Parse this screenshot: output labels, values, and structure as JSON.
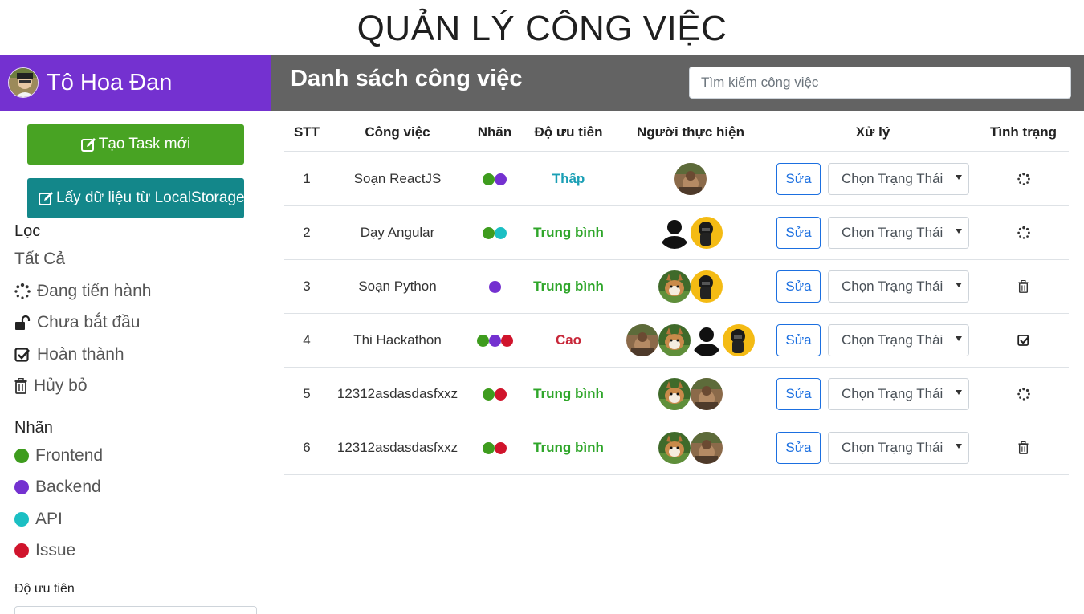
{
  "app": {
    "title": "QUẢN LÝ CÔNG VIỆC"
  },
  "user": {
    "name": "Tô Hoa Đan"
  },
  "header": {
    "title": "Danh sách công việc"
  },
  "search": {
    "placeholder": "Tìm kiếm công việc",
    "value": ""
  },
  "sidebar": {
    "new_task_label": "Tạo Task mới",
    "local_storage_label": "Lấy dữ liệu từ LocalStorage",
    "filter_title": "Lọc",
    "filters": [
      {
        "label": "Tất Cả",
        "icon": ""
      },
      {
        "label": "Đang tiến hành",
        "icon": "spinner-icon"
      },
      {
        "label": "Chưa bắt đầu",
        "icon": "unlock-icon"
      },
      {
        "label": "Hoàn thành",
        "icon": "check-square-icon"
      },
      {
        "label": "Hủy bỏ",
        "icon": "trash-icon"
      }
    ],
    "labels_title": "Nhãn",
    "labels": [
      {
        "label": "Frontend",
        "color": "#3e9c1e"
      },
      {
        "label": "Backend",
        "color": "#7431d0"
      },
      {
        "label": "API",
        "color": "#1bbfc3"
      },
      {
        "label": "Issue",
        "color": "#d0142c"
      }
    ],
    "priority_title": "Độ ưu tiên"
  },
  "table": {
    "headers": [
      "STT",
      "Công việc",
      "Nhãn",
      "Độ ưu tiên",
      "Người thực hiện",
      "Xử lý",
      "Tình trạng"
    ],
    "edit_label": "Sửa",
    "status_select_label": "Chọn Trạng Thái",
    "rows": [
      {
        "stt": "1",
        "task": "Soạn ReactJS",
        "tags": [
          "#3e9c1e",
          "#7431d0"
        ],
        "priority": "Thấp",
        "priority_color": "#1a9fb5",
        "people": [
          "dog"
        ],
        "status_icon": "spinner-icon"
      },
      {
        "stt": "2",
        "task": "Dạy Angular",
        "tags": [
          "#3e9c1e",
          "#1bbfc3"
        ],
        "priority": "Trung bình",
        "priority_color": "#2fa62a",
        "people": [
          "silhouette",
          "yellow"
        ],
        "status_icon": "spinner-icon"
      },
      {
        "stt": "3",
        "task": "Soạn Python",
        "tags": [
          "#7431d0"
        ],
        "priority": "Trung bình",
        "priority_color": "#2fa62a",
        "people": [
          "corgi",
          "yellow"
        ],
        "status_icon": "trash-icon"
      },
      {
        "stt": "4",
        "task": "Thi Hackathon",
        "tags": [
          "#3e9c1e",
          "#7431d0",
          "#d0142c"
        ],
        "priority": "Cao",
        "priority_color": "#c8283a",
        "people": [
          "dog",
          "corgi",
          "silhouette",
          "yellow"
        ],
        "status_icon": "check-square-icon"
      },
      {
        "stt": "5",
        "task": "12312asdasdasfxxz",
        "tags": [
          "#3e9c1e",
          "#d0142c"
        ],
        "priority": "Trung bình",
        "priority_color": "#2fa62a",
        "people": [
          "corgi",
          "dog"
        ],
        "status_icon": "spinner-icon"
      },
      {
        "stt": "6",
        "task": "12312asdasdasfxxz",
        "tags": [
          "#3e9c1e",
          "#d0142c"
        ],
        "priority": "Trung bình",
        "priority_color": "#2fa62a",
        "people": [
          "corgi",
          "dog"
        ],
        "status_icon": "trash-icon"
      }
    ]
  }
}
